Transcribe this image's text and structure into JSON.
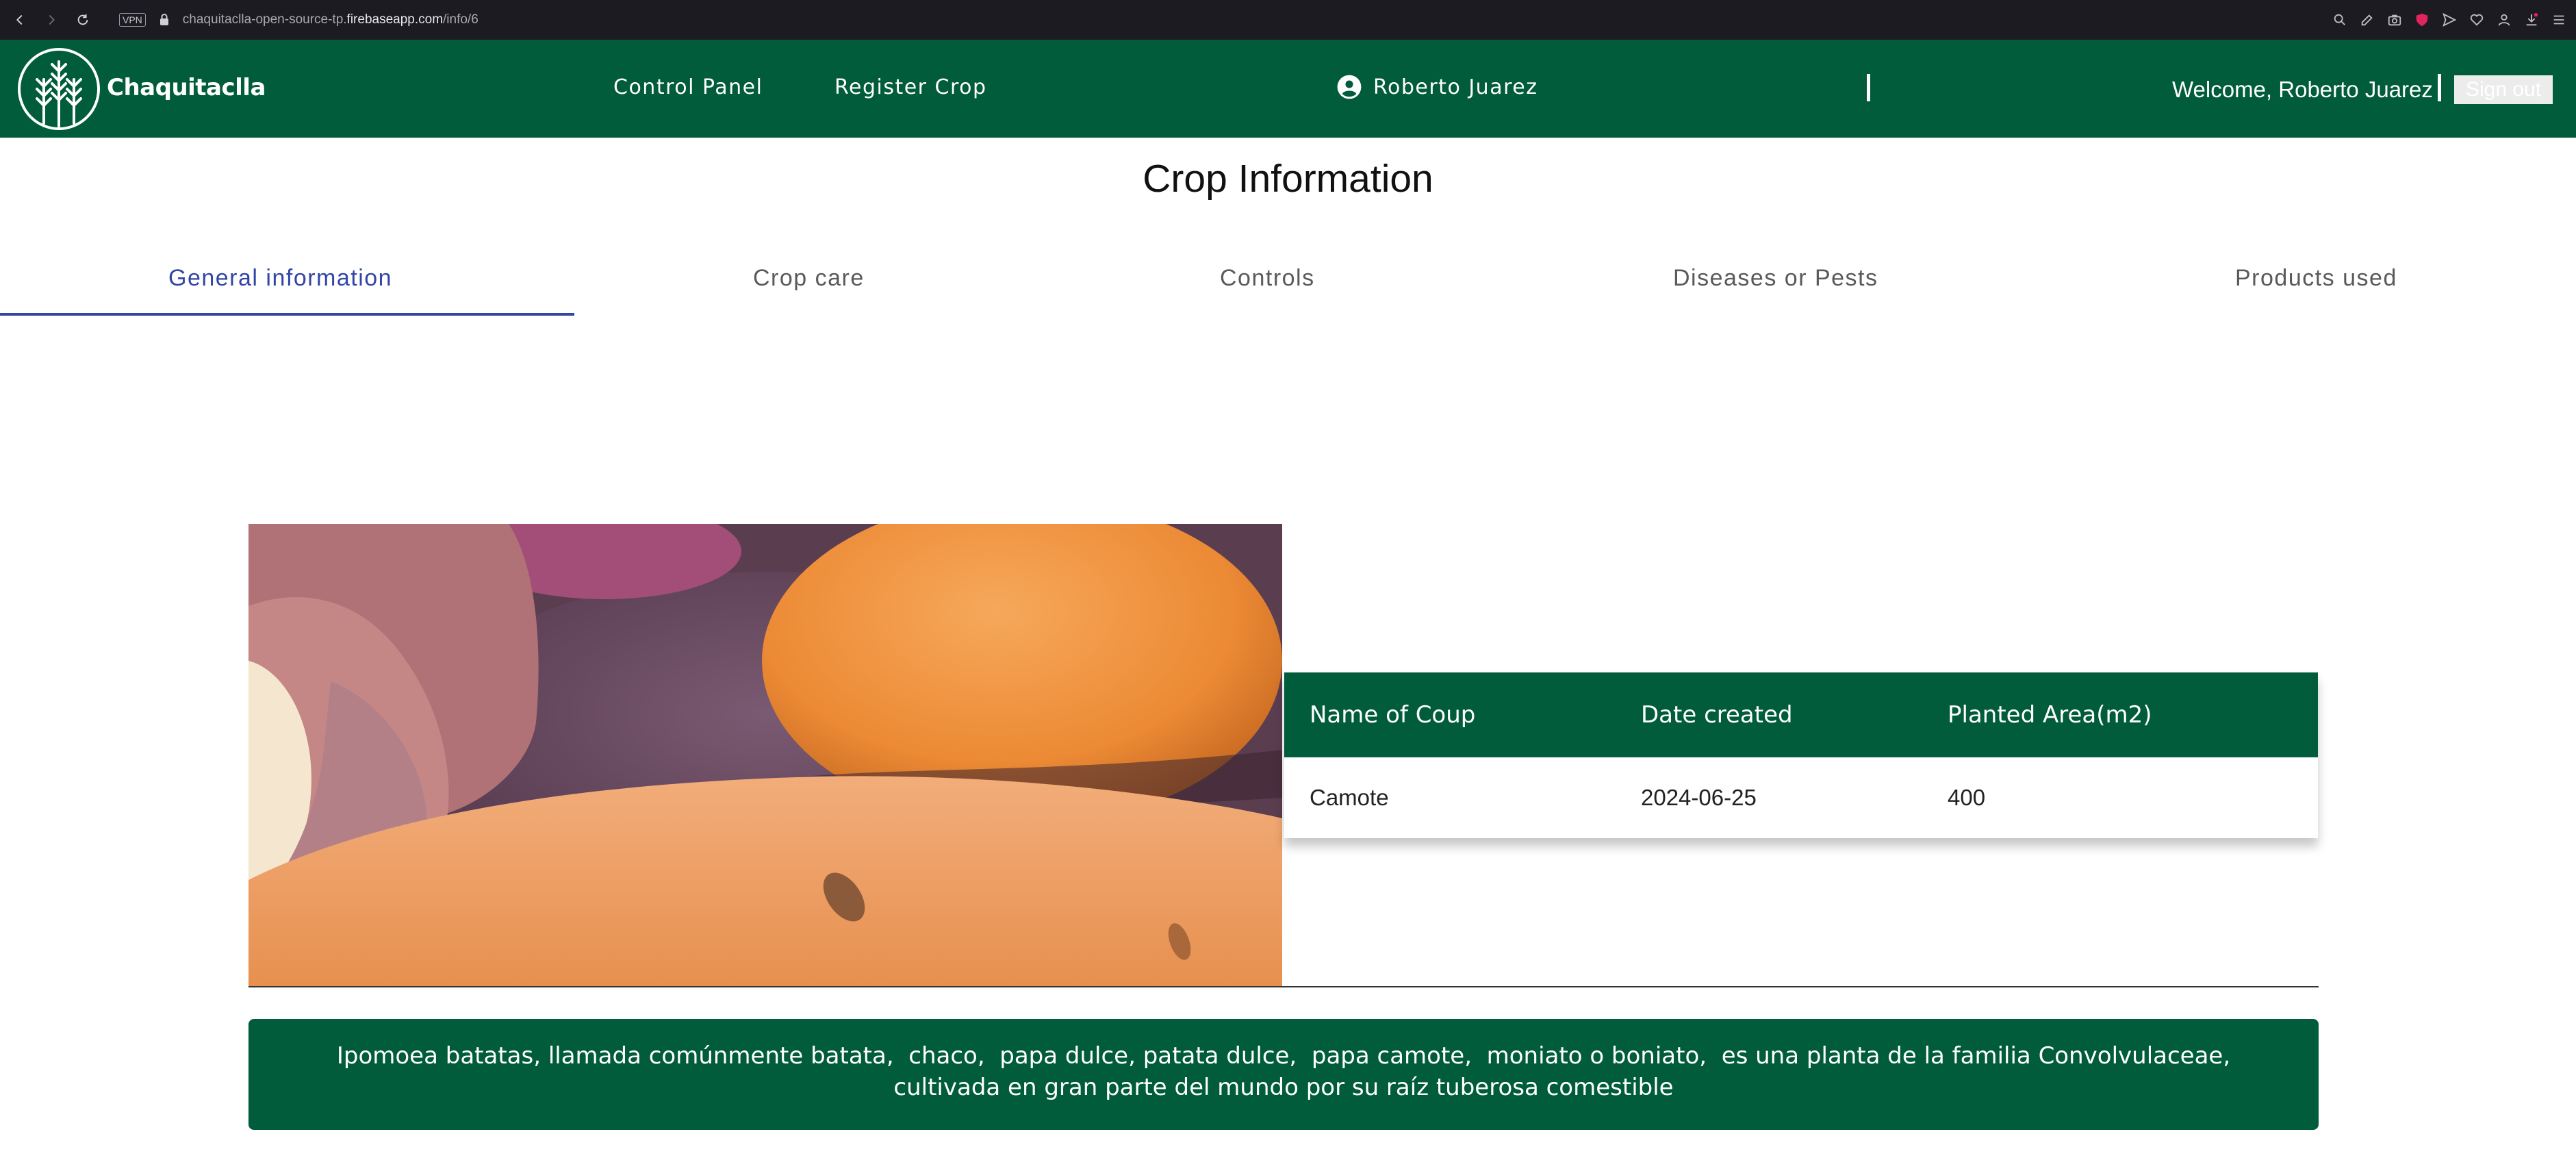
{
  "browser": {
    "vpn_label": "VPN",
    "url_prefix": "chaquitaclla-open-source-tp.",
    "url_host": "firebaseapp.com",
    "url_path": "/info/6"
  },
  "header": {
    "brand": "Chaquitaclla",
    "nav": [
      "Control Panel",
      "Register Crop"
    ],
    "user": "Roberto Juarez",
    "welcome": "Welcome, Roberto Juarez",
    "sign_out": "Sign out"
  },
  "page": {
    "title": "Crop Information"
  },
  "tabs": [
    {
      "label": "General information",
      "active": true
    },
    {
      "label": "Crop care",
      "active": false
    },
    {
      "label": "Controls",
      "active": false
    },
    {
      "label": "Diseases or Pests",
      "active": false
    },
    {
      "label": "Products used",
      "active": false
    }
  ],
  "table": {
    "headers": [
      "Name of Coup",
      "Date created",
      "Planted Area(m2)"
    ],
    "row": [
      "Camote",
      "2024-06-25",
      "400"
    ]
  },
  "description": "Ipomoea batatas, llamada comúnmente batata,  chaco,  papa dulce, patata dulce,  papa camote,  moniato o boniato,  es una planta de la familia Convolvulaceae, cultivada en gran parte del mundo por su raíz tuberosa comestible",
  "colors": {
    "brand_green": "#005c3a",
    "tab_active": "#3346a5",
    "chrome_bg": "#1c1b22"
  }
}
